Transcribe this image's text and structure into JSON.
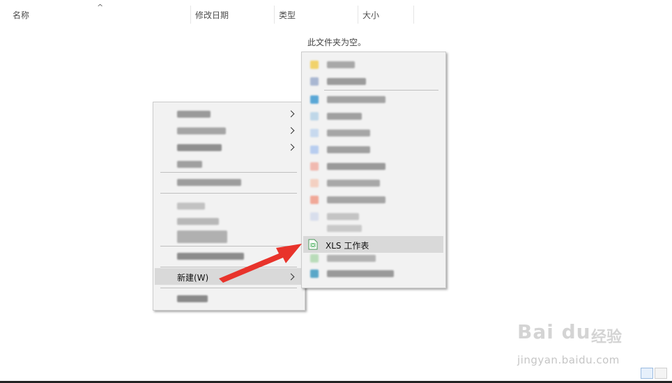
{
  "columns": [
    {
      "id": "name",
      "label": "名称"
    },
    {
      "id": "date",
      "label": "修改日期"
    },
    {
      "id": "type",
      "label": "类型"
    },
    {
      "id": "size",
      "label": "大小"
    }
  ],
  "sort_indicator": "^",
  "empty_message": "此文件夹为空。",
  "context_menu": {
    "new_item_label": "新建(W)"
  },
  "submenu": {
    "xls_item_label": "XLS 工作表"
  },
  "watermark": {
    "logo": "Bai du",
    "text": "经验",
    "url": "jingyan.baidu.com"
  },
  "colors": {
    "arrow": "#e8332b",
    "highlight": "#d9d9d9",
    "menu_bg": "#f2f2f2"
  }
}
